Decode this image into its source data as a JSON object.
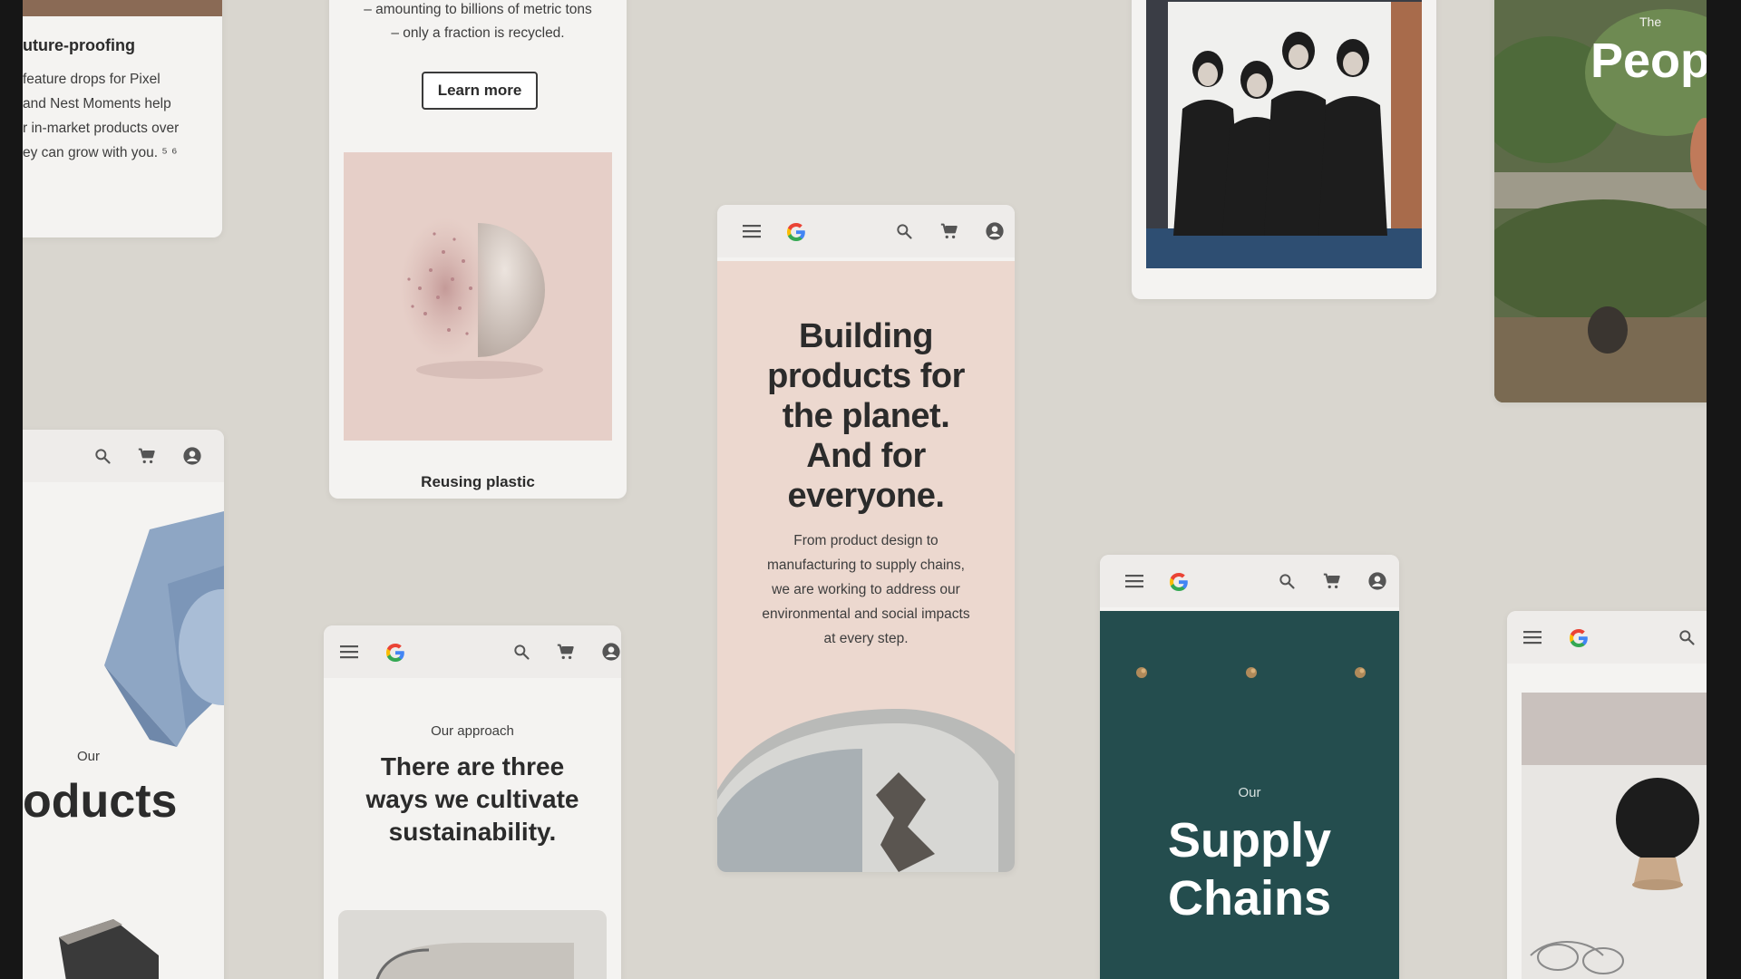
{
  "colors": {
    "frame": "#161616",
    "canvas": "#d9d6cf",
    "card": "#f4f3f1",
    "hero_pink": "#ecd8cf",
    "supply_teal": "#244d4e",
    "text_dark": "#2b2b2b"
  },
  "icons": {
    "menu": "hamburger-icon",
    "logo": "google-g-logo",
    "search": "search-icon",
    "cart": "cart-icon",
    "account": "account-icon"
  },
  "card_future": {
    "heading": "uture-proofing",
    "lines": [
      "feature drops for Pixel",
      "and Nest Moments help",
      "r in-market products over",
      "ey can grow with you. ⁵ ⁶"
    ]
  },
  "card_recycling": {
    "lines": [
      "– amounting to billions of metric tons",
      "– only a fraction is recycled."
    ],
    "button_label": "Learn more",
    "caption": "Reusing plastic"
  },
  "card_products": {
    "eyebrow": "Our",
    "title": "oducts"
  },
  "card_approach": {
    "eyebrow": "Our approach",
    "title_lines": [
      "There are three",
      "ways we cultivate",
      "sustainability."
    ]
  },
  "card_hero": {
    "title_lines": [
      "Building",
      "products for",
      "the planet.",
      "And for",
      "everyone."
    ],
    "body_lines": [
      "From product design to",
      "manufacturing to supply chains,",
      "we are working to address our",
      "environmental and social impacts",
      "at every step."
    ]
  },
  "card_supply": {
    "eyebrow": "Our",
    "title_lines": [
      "Supply",
      "Chains"
    ]
  },
  "card_people": {
    "eyebrow": "The",
    "title": "People"
  }
}
